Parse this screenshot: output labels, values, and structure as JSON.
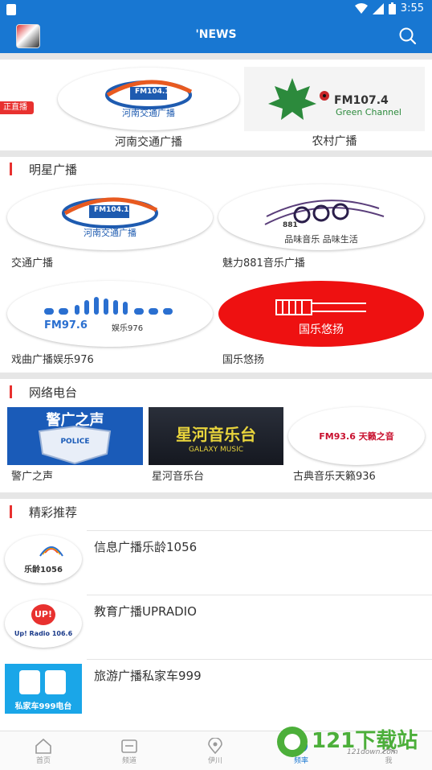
{
  "status_bar": {
    "time": "3:55"
  },
  "app_bar": {
    "title": "'NEWS"
  },
  "top": {
    "live_tag": "正直播",
    "items": [
      {
        "label": "河南交通广播",
        "logo_text": "河南交通广播",
        "logo_sub": "FM104.1"
      },
      {
        "label": "农村广播",
        "logo_text": "FM107.4",
        "logo_sub": "Green Channel"
      }
    ]
  },
  "sections": {
    "star": {
      "title": "明星广播",
      "items": [
        {
          "label": "交通广播",
          "logo_text": "河南交通广播",
          "logo_sub": "FM104.1"
        },
        {
          "label": "魅力881音乐广播",
          "logo_text": "881",
          "logo_sub": "品味音乐  品味生活"
        },
        {
          "label": "戏曲广播娱乐976",
          "logo_text": "FM97.6",
          "logo_sub": "娱乐976"
        },
        {
          "label": "国乐悠扬",
          "logo_text": "国乐悠扬"
        }
      ]
    },
    "network": {
      "title": "网络电台",
      "items": [
        {
          "label": "警广之声",
          "logo_text": "警广之声",
          "logo_sub": "POLICE"
        },
        {
          "label": "星河音乐台",
          "logo_text": "星河音乐台",
          "logo_sub": "GALAXY MUSIC"
        },
        {
          "label": "古典音乐天籁936",
          "logo_text": "FM93.6 天籁之音"
        }
      ]
    },
    "recommend": {
      "title": "精彩推荐",
      "items": [
        {
          "name": "信息广播乐龄1056",
          "logo_text": "乐龄1056"
        },
        {
          "name": "教育广播UPRADIO",
          "logo_text": "UP!",
          "logo_sub": "Up! Radio 106.6"
        },
        {
          "name": "旅游广播私家车999",
          "logo_text": "私家车999电台"
        }
      ]
    }
  },
  "bottom_nav": [
    {
      "label": "首页",
      "icon": "home-icon"
    },
    {
      "label": "频道",
      "icon": "channel-icon"
    },
    {
      "label": "伊川",
      "icon": "location-icon"
    },
    {
      "label": "频率",
      "icon": "frequency-icon"
    },
    {
      "label": "我",
      "icon": "profile-icon"
    }
  ],
  "watermark": {
    "text": "121下载站",
    "sub": "121down.com"
  },
  "colors": {
    "primary": "#1877d2",
    "accent_red": "#e8312f",
    "divider": "#e6e6e6"
  }
}
